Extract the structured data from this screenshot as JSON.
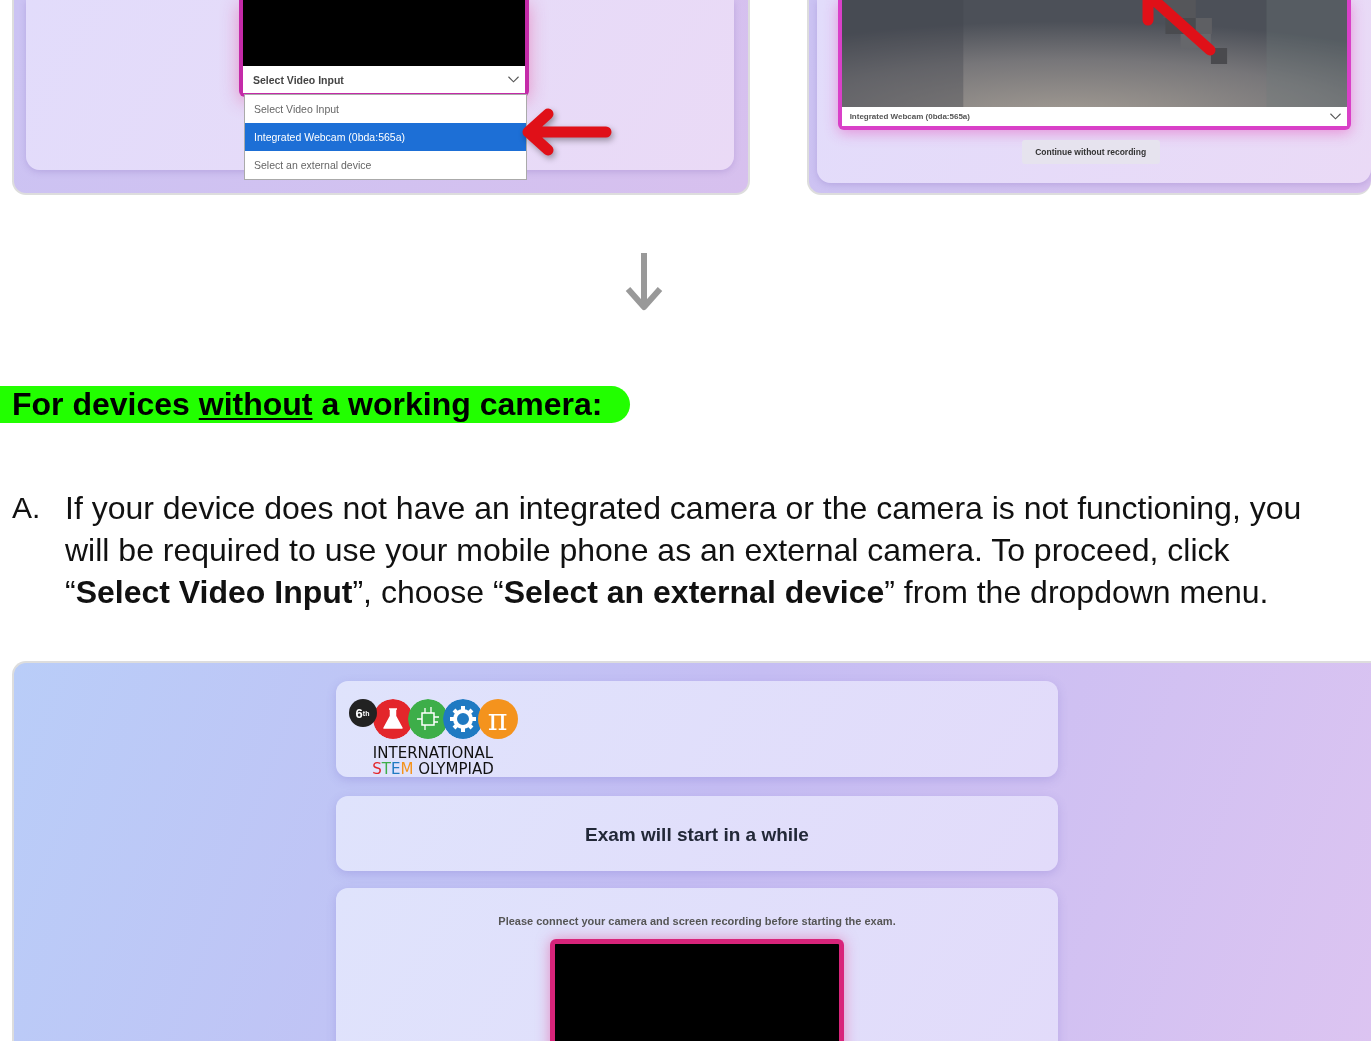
{
  "top_left_screenshot": {
    "select": {
      "label": "Select Video Input"
    },
    "options": [
      {
        "label": "Select Video Input",
        "selected": false
      },
      {
        "label": "Integrated Webcam (0bda:565a)",
        "selected": true
      },
      {
        "label": "Select an external device",
        "selected": false
      }
    ]
  },
  "top_right_screenshot": {
    "select": {
      "value": "Integrated Webcam (0bda:565a)"
    },
    "button": "Continue without recording"
  },
  "section_heading": {
    "before": "For devices ",
    "underlined": "without",
    "after": " a working camera:"
  },
  "steps": [
    {
      "marker": "A.",
      "text": "If your device does not have an integrated camera or the camera is not functioning, you will be required to use your mobile phone as an external camera. To proceed, click “**Select Video Input**”, choose “**Select an external device**” from the dropdown menu."
    }
  ],
  "bottom_screenshot": {
    "logo": {
      "edition": "6$^{th}$",
      "symbol": "π",
      "line1": "INTERNATIONAL",
      "line2": "STEM OLYMPIAD"
    },
    "status": "Exam will start in a while",
    "instruction": "Please connect your camera and screen recording before starting the exam."
  }
}
